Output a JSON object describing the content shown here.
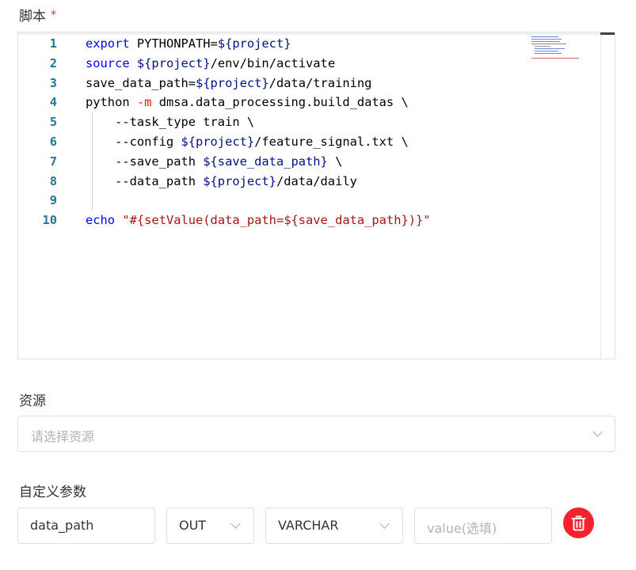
{
  "script_section": {
    "label": "脚本",
    "required_mark": "*",
    "code_lines": [
      {
        "num": "1",
        "tokens": [
          {
            "t": "export",
            "c": "kw"
          },
          {
            "t": " PYTHONPATH=",
            "c": ""
          },
          {
            "t": "${project}",
            "c": "var"
          }
        ]
      },
      {
        "num": "2",
        "tokens": [
          {
            "t": "source",
            "c": "kw"
          },
          {
            "t": " ",
            "c": ""
          },
          {
            "t": "${project}",
            "c": "var"
          },
          {
            "t": "/env/bin/activate",
            "c": ""
          }
        ]
      },
      {
        "num": "3",
        "tokens": [
          {
            "t": "save_data_path=",
            "c": ""
          },
          {
            "t": "${project}",
            "c": "var"
          },
          {
            "t": "/data/training",
            "c": ""
          }
        ]
      },
      {
        "num": "4",
        "tokens": [
          {
            "t": "python ",
            "c": ""
          },
          {
            "t": "-m",
            "c": "op"
          },
          {
            "t": " dmsa.data_processing.build_datas \\",
            "c": ""
          }
        ]
      },
      {
        "num": "5",
        "tokens": [
          {
            "t": "    --task_type train \\",
            "c": ""
          }
        ]
      },
      {
        "num": "6",
        "tokens": [
          {
            "t": "    --config ",
            "c": ""
          },
          {
            "t": "${project}",
            "c": "var"
          },
          {
            "t": "/feature_signal.txt \\",
            "c": ""
          }
        ]
      },
      {
        "num": "7",
        "tokens": [
          {
            "t": "    --save_path ",
            "c": ""
          },
          {
            "t": "${save_data_path}",
            "c": "var"
          },
          {
            "t": " \\",
            "c": ""
          }
        ]
      },
      {
        "num": "8",
        "tokens": [
          {
            "t": "    --data_path ",
            "c": ""
          },
          {
            "t": "${project}",
            "c": "var"
          },
          {
            "t": "/data/daily",
            "c": ""
          }
        ]
      },
      {
        "num": "9",
        "tokens": []
      },
      {
        "num": "10",
        "tokens": [
          {
            "t": "echo",
            "c": "kw"
          },
          {
            "t": " ",
            "c": ""
          },
          {
            "t": "\"#{setValue(data_path=${save_data_path})}\"",
            "c": "str"
          }
        ]
      }
    ]
  },
  "resource_section": {
    "label": "资源",
    "placeholder": "请选择资源"
  },
  "params_section": {
    "label": "自定义参数",
    "row": {
      "name": "data_path",
      "direction": "OUT",
      "type": "VARCHAR",
      "value_placeholder": "value(选填)"
    }
  },
  "icons": {
    "required": "asterisk",
    "dropdown": "chevron-down-icon",
    "delete": "trash-icon"
  },
  "colors": {
    "keyword": "#0000ff",
    "variable": "#001080",
    "operator": "#e51400",
    "string": "#a31515",
    "line_number": "#237893",
    "delete_button": "#f5222d"
  }
}
